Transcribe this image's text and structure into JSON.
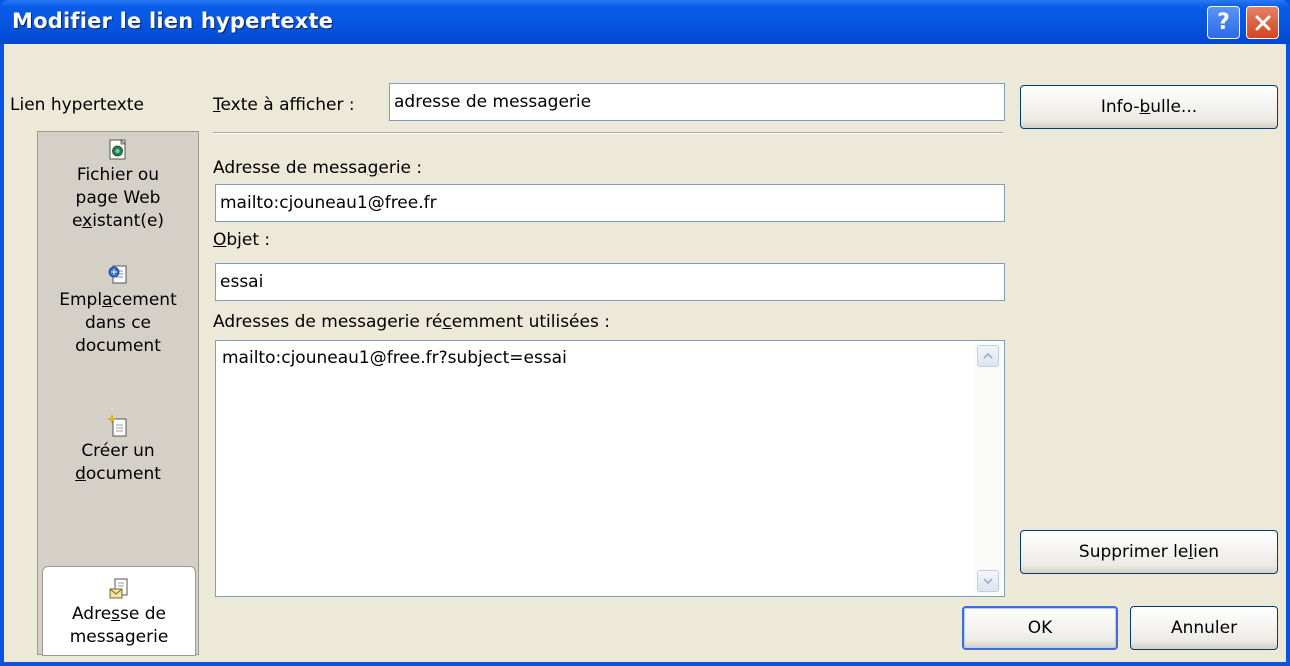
{
  "window": {
    "title": "Modifier le lien hypertexte",
    "help_label": "?",
    "close_label": "✕"
  },
  "nav": {
    "header": "Lien hypertexte",
    "items": [
      {
        "label_line1": "Fichier ou",
        "label_line2": "page Web",
        "label_line3_pre": "e",
        "label_line3_u": "x",
        "label_line3_post": "istant(e)",
        "icon": "web-page-icon"
      },
      {
        "label_line1_pre": "Empl",
        "label_line1_u": "a",
        "label_line1_post": "cement",
        "label_line2": "dans ce",
        "label_line3": "document",
        "icon": "document-place-icon"
      },
      {
        "label_line1": "Créer un",
        "label_line2_u": "d",
        "label_line2_post": "ocument",
        "icon": "new-document-icon"
      },
      {
        "label_line1_pre": "Adre",
        "label_line1_u": "s",
        "label_line1_post": "se de",
        "label_line2": "messagerie",
        "icon": "email-address-icon",
        "selected": true
      }
    ]
  },
  "form": {
    "display_text_label_u": "T",
    "display_text_label_post": "exte à afficher :",
    "display_text_value": "adresse de messagerie",
    "email_label_pre": "Adresse de messa",
    "email_label_u": "g",
    "email_label_post": "erie :",
    "email_value": "mailto:cjouneau1@free.fr",
    "subject_label_u": "O",
    "subject_label_post": "bjet :",
    "subject_value": "essai",
    "recent_label_pre": "Adresses de messagerie ré",
    "recent_label_u": "c",
    "recent_label_post": "emment utilisées :",
    "recent_items": [
      "mailto:cjouneau1@free.fr?subject=essai"
    ]
  },
  "buttons": {
    "screentip_pre": "Info-",
    "screentip_u": "b",
    "screentip_post": "ulle...",
    "remove_link_pre": "Supprimer le ",
    "remove_link_u": "l",
    "remove_link_post": "ien",
    "ok": "OK",
    "cancel": "Annuler"
  },
  "colors": {
    "titlebar": "#0554e0",
    "dialog_face": "#ece9d8",
    "close_button": "#d2451e",
    "field_border": "#7f9db9"
  }
}
